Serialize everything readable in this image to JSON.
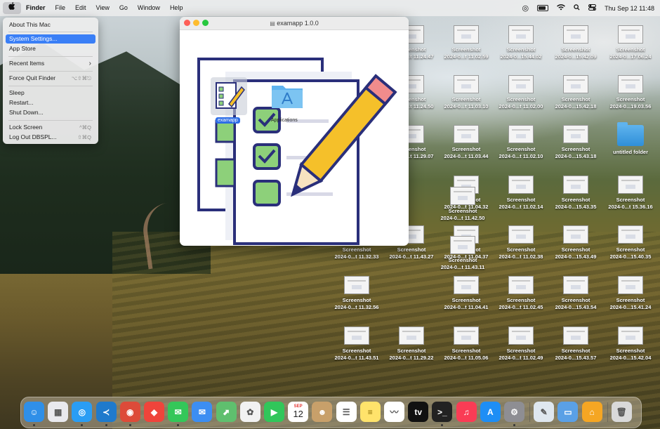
{
  "menubar": {
    "apple_icon": "apple-icon",
    "app": "Finder",
    "items": [
      "File",
      "Edit",
      "View",
      "Go",
      "Window",
      "Help"
    ],
    "clock": "Thu Sep 12  11:48"
  },
  "apple_menu": {
    "items": [
      {
        "label": "About This Mac",
        "shortcut": ""
      },
      {
        "label": "System Settings...",
        "shortcut": ""
      },
      {
        "label": "App Store",
        "shortcut": ""
      },
      {
        "label": "Recent Items",
        "shortcut": "›"
      },
      {
        "label": "Force Quit Finder",
        "shortcut": "⌥⇧⌘⎋"
      },
      {
        "label": "Sleep",
        "shortcut": ""
      },
      {
        "label": "Restart...",
        "shortcut": ""
      },
      {
        "label": "Shut Down...",
        "shortcut": ""
      },
      {
        "label": "Lock Screen",
        "shortcut": "^⌘Q"
      },
      {
        "label": "Log Out DBSPL...",
        "shortcut": "⇧⌘Q"
      }
    ],
    "highlighted": "System Settings..."
  },
  "window": {
    "title": "examapp 1.0.0",
    "app_label": "examapp",
    "applications_label": "Applications"
  },
  "desktop_icons": [
    {
      "l1": "Screenshot",
      "l2": "2024-0...t 11.24.47"
    },
    {
      "l1": "Screenshot",
      "l2": "2024-0...t 11.02.59"
    },
    {
      "l1": "Screenshot",
      "l2": "2024-0...15.44.02"
    },
    {
      "l1": "Screenshot",
      "l2": "2024-0...15.42.09"
    },
    {
      "l1": "Screenshot",
      "l2": "2024-0...17.06.24"
    },
    {
      "l1": "Screenshot",
      "l2": "2024-0...t 11.24.50"
    },
    {
      "l1": "Screenshot",
      "l2": "2024-0...t 11.03.10"
    },
    {
      "l1": "Screenshot",
      "l2": "2024-0...t 11.02.00"
    },
    {
      "l1": "Screenshot",
      "l2": "2024-0...15.42.18"
    },
    {
      "l1": "Screenshot",
      "l2": "2024-0...19.03.56"
    },
    {
      "l1": "Screenshot",
      "l2": "2024-0...t 11.29.07"
    },
    {
      "l1": "Screenshot",
      "l2": "2024-0...t 11.03.44"
    },
    {
      "l1": "Screenshot",
      "l2": "2024-0...t 11.02.10"
    },
    {
      "l1": "Screenshot",
      "l2": "2024-0...15.43.18"
    },
    {
      "l1": "untitled folder",
      "l2": ""
    },
    {
      "l1": "Screenshot",
      "l2": "2024-0...t 11.04.32"
    },
    {
      "l1": "Screenshot",
      "l2": "2024-0...t 11.02.14"
    },
    {
      "l1": "Screenshot",
      "l2": "2024-0...15.43.35"
    },
    {
      "l1": "Screenshot",
      "l2": "2024-0...t 15.36.16"
    },
    {
      "l1": "Screenshot",
      "l2": "2024-0...t 11.42.50"
    },
    {
      "l1": "Screenshot",
      "l2": "2024-0...t 11.32.33"
    },
    {
      "l1": "Screenshot",
      "l2": "2024-0...t 11.43.27"
    },
    {
      "l1": "Screenshot",
      "l2": "2024-0...t 11.04.37"
    },
    {
      "l1": "Screenshot",
      "l2": "2024-0...t 11.02.38"
    },
    {
      "l1": "Screenshot",
      "l2": "2024-0...15.43.49"
    },
    {
      "l1": "Screenshot",
      "l2": "2024-0...15.40.35"
    },
    {
      "l1": "Screenshot",
      "l2": "2024-0...t 11.43.11"
    },
    {
      "l1": "Screenshot",
      "l2": "2024-0...t 11.32.56"
    },
    {
      "l1": "Screenshot",
      "l2": "2024-0...t 11.04.41"
    },
    {
      "l1": "Screenshot",
      "l2": "2024-0...t 11.02.45"
    },
    {
      "l1": "Screenshot",
      "l2": "2024-0...15.43.54"
    },
    {
      "l1": "Screenshot",
      "l2": "2024-0...15.41.24"
    },
    {
      "l1": "Screenshot",
      "l2": "2024-0...t 11.43.51"
    },
    {
      "l1": "Screenshot",
      "l2": "2024-0...t 11.29.22"
    },
    {
      "l1": "Screenshot",
      "l2": "2024-0...t 11.05.06"
    },
    {
      "l1": "Screenshot",
      "l2": "2024-0...t 11.02.49"
    },
    {
      "l1": "Screenshot",
      "l2": "2024-0...15.43.57"
    },
    {
      "l1": "Screenshot",
      "l2": "2024-0...15.42.04"
    }
  ],
  "dock": {
    "calendar_month": "SEP",
    "calendar_day": "12",
    "apps": [
      {
        "name": "finder-icon",
        "color": "#2f8fe8",
        "glyph": "☺"
      },
      {
        "name": "launchpad-icon",
        "color": "#e9e9ee",
        "glyph": "▦"
      },
      {
        "name": "safari-icon",
        "color": "#2a9df4",
        "glyph": "◎"
      },
      {
        "name": "vscode-icon",
        "color": "#1f7acc",
        "glyph": "≺"
      },
      {
        "name": "chrome-icon",
        "color": "#dd4b39",
        "glyph": "◉"
      },
      {
        "name": "anydesk-icon",
        "color": "#ef443b",
        "glyph": "◆"
      },
      {
        "name": "messages-icon",
        "color": "#34c759",
        "glyph": "✉"
      },
      {
        "name": "mail-icon",
        "color": "#3c8ef2",
        "glyph": "✉"
      },
      {
        "name": "maps-icon",
        "color": "#5fbf6e",
        "glyph": "⬈"
      },
      {
        "name": "photos-icon",
        "color": "#f2f2f2",
        "glyph": "✿"
      },
      {
        "name": "facetime-icon",
        "color": "#31c65a",
        "glyph": "▶"
      },
      {
        "name": "calendar-icon",
        "color": "#ffffff",
        "glyph": ""
      },
      {
        "name": "contacts-icon",
        "color": "#c8a06a",
        "glyph": "☻"
      },
      {
        "name": "reminders-icon",
        "color": "#ffffff",
        "glyph": "☰"
      },
      {
        "name": "notes-icon",
        "color": "#ffe36b",
        "glyph": "≡"
      },
      {
        "name": "freeform-icon",
        "color": "#ffffff",
        "glyph": "〰"
      },
      {
        "name": "appletv-icon",
        "color": "#111111",
        "glyph": "tv"
      },
      {
        "name": "terminal-icon",
        "color": "#222222",
        "glyph": ">_"
      },
      {
        "name": "music-icon",
        "color": "#fa3c55",
        "glyph": "♫"
      },
      {
        "name": "appstore-icon",
        "color": "#1e8ef5",
        "glyph": "A"
      },
      {
        "name": "system-settings-icon",
        "color": "#8e8e93",
        "glyph": "⚙"
      },
      {
        "name": "preview-icon",
        "color": "#dfe7ef",
        "glyph": "✎"
      },
      {
        "name": "screensharing-icon",
        "color": "#5aa0e6",
        "glyph": "▭"
      },
      {
        "name": "home-icon",
        "color": "#f5a623",
        "glyph": "⌂"
      },
      {
        "name": "trash-icon",
        "color": "#d9d9d9",
        "glyph": "🗑"
      }
    ]
  }
}
